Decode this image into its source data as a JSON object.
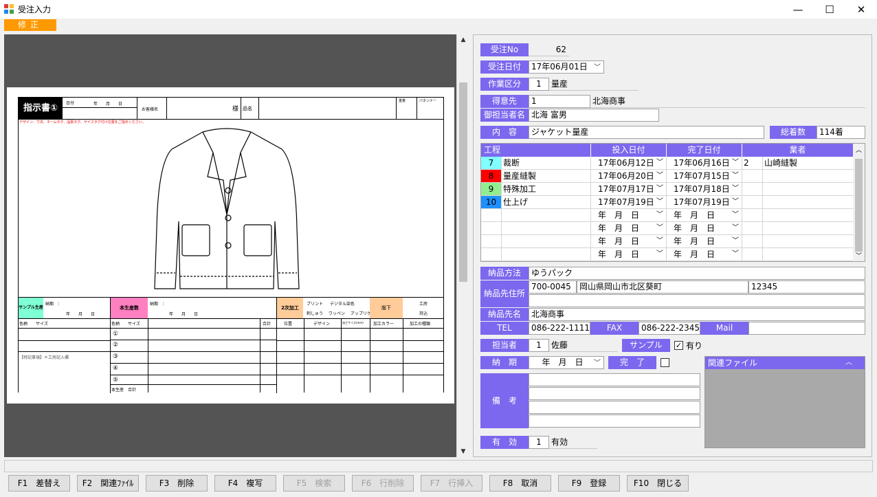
{
  "window": {
    "title": "受注入力",
    "minimize": "—",
    "maximize": "☐",
    "close": "✕"
  },
  "mode": "修正",
  "sheet": {
    "title": "指示書①",
    "date_label": "日付",
    "date_ym": "年　　月　　日",
    "customer_label": "お客様名",
    "sama": "様",
    "item_label": "品名",
    "note_red": "デザイン、寸法、ネームタグ、品質タグ、サイズタグ付け位置をご指示ください。",
    "sample_label": "サンプル生産",
    "deadline": "納期　：",
    "ymd": "年　　月　　日",
    "prod_label": "本生産数",
    "secondary_label": "2次加工",
    "opt_print": "プリント",
    "opt_dye": "デジタル染色",
    "opt_embroidery": "刺しゅう",
    "opt_wappen": "ワッペン",
    "opt_applique": "アップリケ",
    "hanshita": "版下",
    "opt_factory": "工房",
    "opt_carry": "持込",
    "col_color_size": "色柄　　サイズ",
    "col_total": "合計",
    "col_pos": "位置",
    "col_design": "デザイン",
    "col_size": "加工サイズ(mm)",
    "col_color": "加工カラー",
    "col_kind": "加工の種類",
    "special": "【特記事項】＊工房記入欄",
    "rows": [
      "①",
      "②",
      "③",
      "④",
      "⑤"
    ],
    "prod_total": "本生産　合計",
    "head1": "重量",
    "head2": "パタンナー"
  },
  "form": {
    "order_no_label": "受注No",
    "order_no": "62",
    "order_date_label": "受注日付",
    "order_date": "17年06月01日",
    "work_type_label": "作業区分",
    "work_type_code": "1",
    "work_type": "量産",
    "client_label": "得意先",
    "client_code": "1",
    "client_name": "北海商事",
    "contact_label": "御担当者名",
    "contact": "北海 富男",
    "content_label": "内　容",
    "content": "ジャケット量産",
    "total_label": "総着数",
    "total": "114着",
    "grid": {
      "headers": [
        "工程",
        "投入日付",
        "完了日付",
        "業者"
      ],
      "rows": [
        {
          "code": "7",
          "color": "#7fffff",
          "name": "裁断",
          "start": "17年06月12日",
          "end": "17年06月16日",
          "vcode": "2",
          "vendor": "山崎縫製"
        },
        {
          "code": "8",
          "color": "#ff0000",
          "name": "量産縫製",
          "start": "17年06月20日",
          "end": "17年07月15日",
          "vcode": "",
          "vendor": ""
        },
        {
          "code": "9",
          "color": "#90ee90",
          "name": "特殊加工",
          "start": "17年07月17日",
          "end": "17年07月18日",
          "vcode": "",
          "vendor": ""
        },
        {
          "code": "10",
          "color": "#1e90ff",
          "name": "仕上げ",
          "start": "17年07月19日",
          "end": "17年07月19日",
          "vcode": "",
          "vendor": ""
        },
        {
          "code": "",
          "color": "#ffffff",
          "name": "",
          "start": "年　月　日",
          "end": "年　月　日",
          "vcode": "",
          "vendor": ""
        },
        {
          "code": "",
          "color": "#ffffff",
          "name": "",
          "start": "年　月　日",
          "end": "年　月　日",
          "vcode": "",
          "vendor": ""
        },
        {
          "code": "",
          "color": "#ffffff",
          "name": "",
          "start": "年　月　日",
          "end": "年　月　日",
          "vcode": "",
          "vendor": ""
        },
        {
          "code": "",
          "color": "#ffffff",
          "name": "",
          "start": "年　月　日",
          "end": "年　月　日",
          "vcode": "",
          "vendor": ""
        }
      ]
    },
    "delivery_method_label": "納品方法",
    "delivery_method": "ゆうパック",
    "delivery_addr_label": "納品先住所",
    "zip": "700-0045",
    "address": "岡山県岡山市北区葵町",
    "addr_num": "12345",
    "delivery_name_label": "納品先名",
    "delivery_name": "北海商事",
    "tel_label": "TEL",
    "tel": "086-222-1111",
    "fax_label": "FAX",
    "fax": "086-222-2345",
    "mail_label": "Mail",
    "mail": "",
    "staff_label": "担当者",
    "staff_code": "1",
    "staff": "佐藤",
    "sample_label": "サンプル",
    "sample_check": "有り",
    "deadline_label": "納　期",
    "deadline": "年　月　日",
    "done_label": "完　了",
    "files_label": "関連ファイル",
    "remarks_label": "備　考",
    "valid_label": "有　効",
    "valid_code": "1",
    "valid": "有効"
  },
  "fkeys": [
    {
      "label": "F1　差替え",
      "enabled": true
    },
    {
      "label": "F2　関連ﾌｧｲﾙ",
      "enabled": true
    },
    {
      "label": "F3　削除",
      "enabled": true
    },
    {
      "label": "F4　複写",
      "enabled": true
    },
    {
      "label": "F5　検索",
      "enabled": false
    },
    {
      "label": "F6　行削除",
      "enabled": false
    },
    {
      "label": "F7　行挿入",
      "enabled": false
    },
    {
      "label": "F8　取消",
      "enabled": true
    },
    {
      "label": "F9　登録",
      "enabled": true
    },
    {
      "label": "F10　閉じる",
      "enabled": true
    }
  ]
}
